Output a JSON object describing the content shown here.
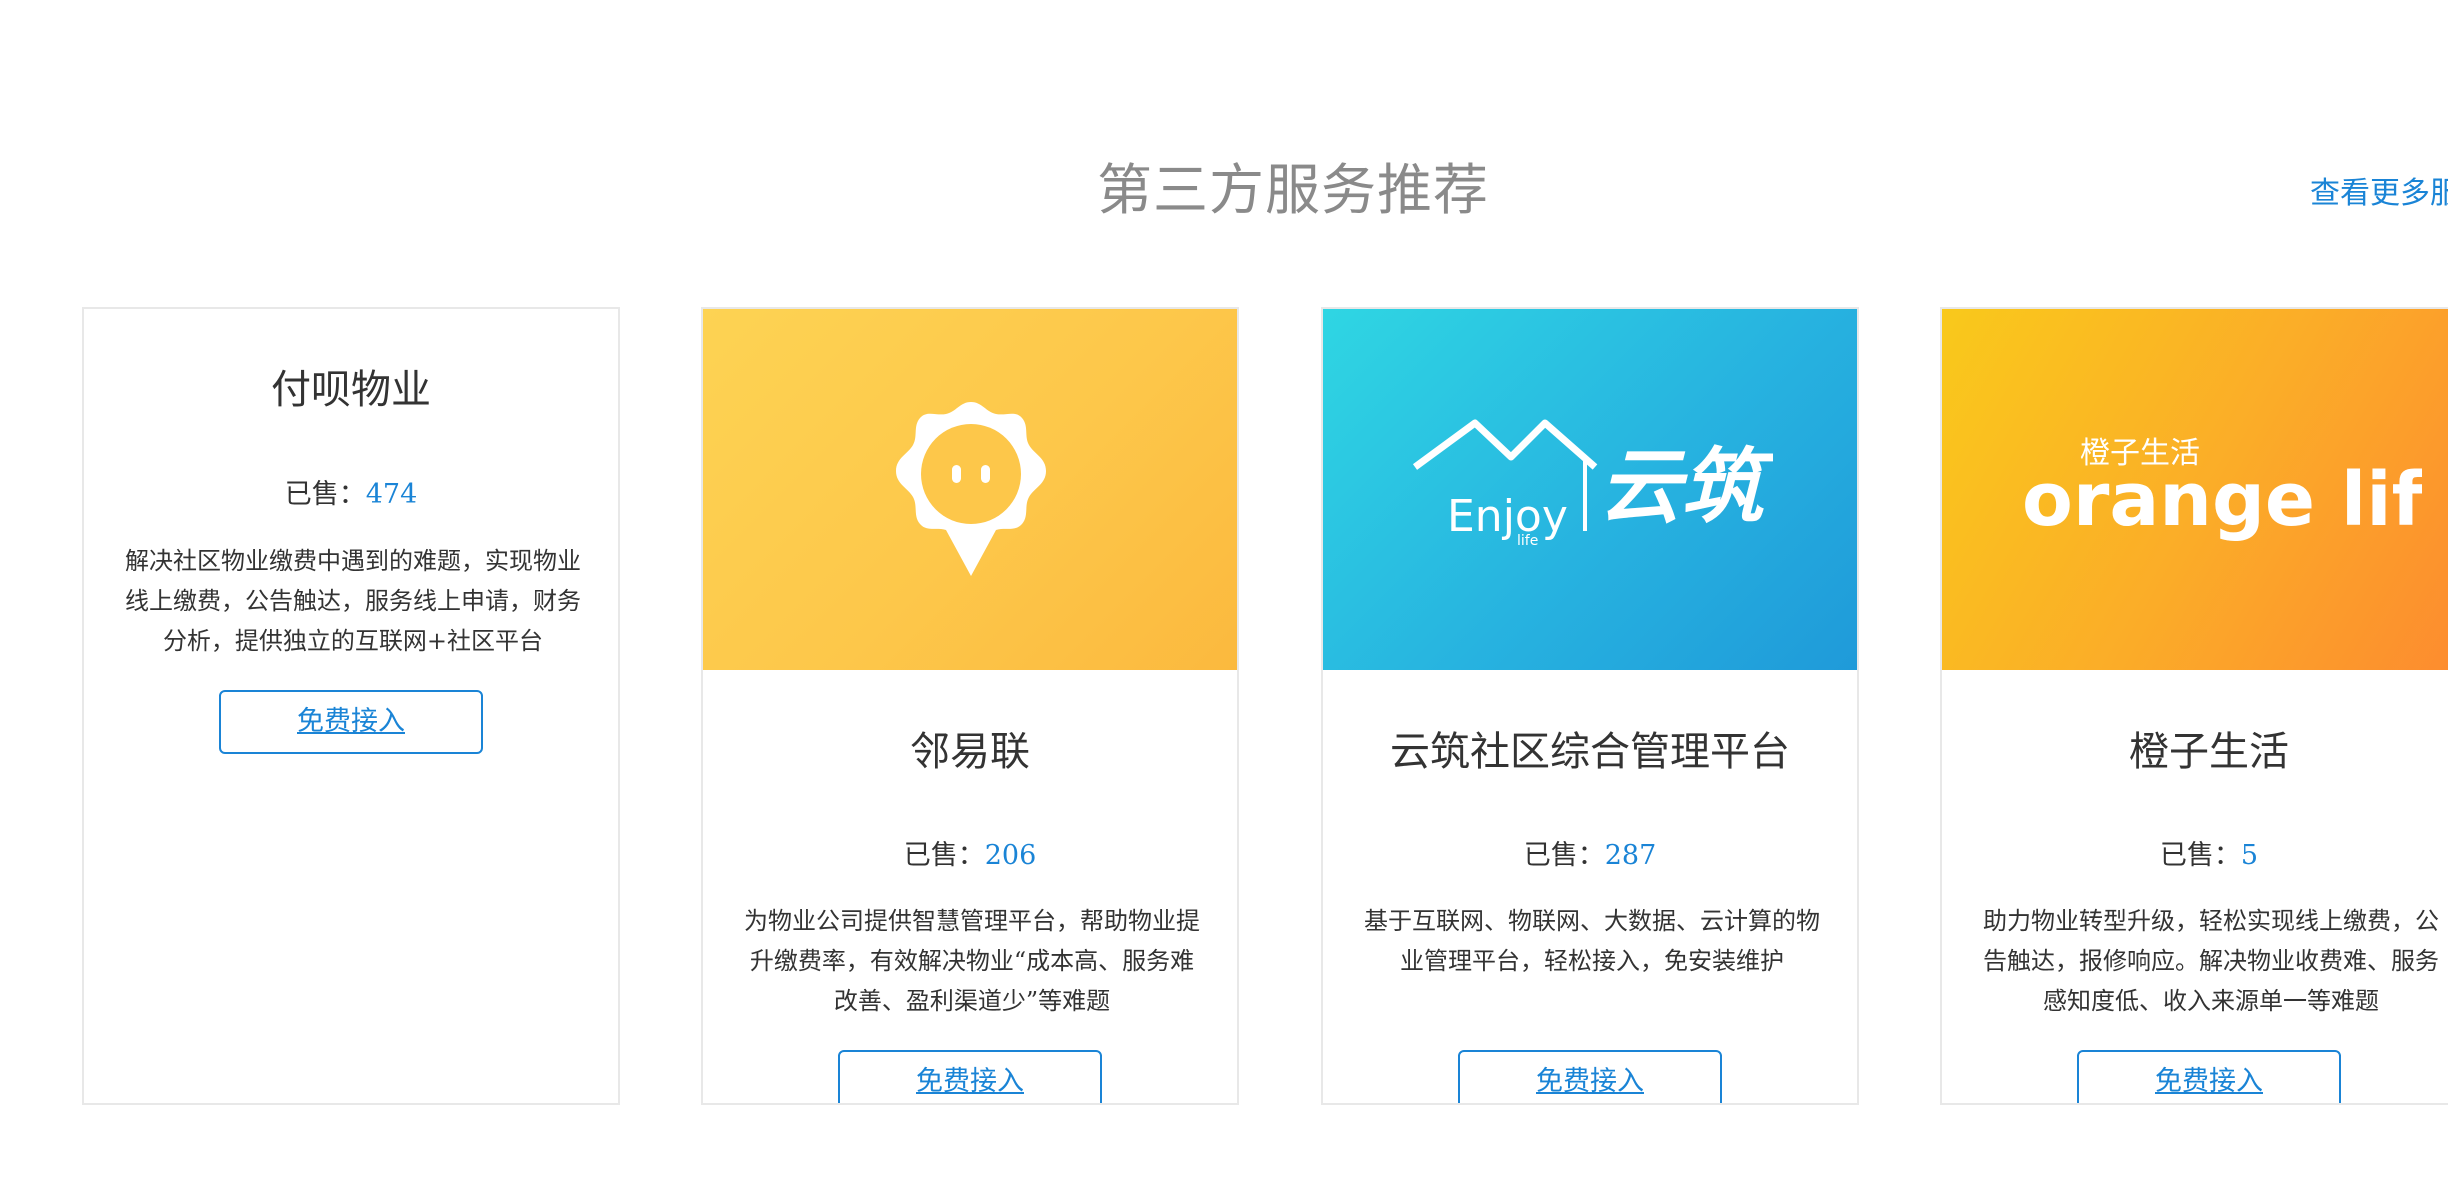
{
  "section": {
    "title": "第三方服务推荐",
    "more_link": "查看更多服"
  },
  "cards": [
    {
      "title": "付呗物业",
      "sold_label": "已售：",
      "sold_count": "474",
      "description": "解决社区物业缴费中遇到的难题，实现物业线上缴费，公告触达，服务线上申请，财务分析，提供独立的互联网+社区平台",
      "button": "免费接入"
    },
    {
      "title": "邻易联",
      "sold_label": "已售：",
      "sold_count": "206",
      "description": "为物业公司提供智慧管理平台，帮助物业提升缴费率，有效解决物业“成本高、服务难改善、盈利渠道少”等难题",
      "button": "免费接入",
      "logo": "linyilian-logo",
      "banner_color": "#fdc74a"
    },
    {
      "title": "云筑社区综合管理平台",
      "sold_label": "已售：",
      "sold_count": "287",
      "description": "基于互联网、物联网、大数据、云计算的物业管理平台，轻松接入，免安装维护",
      "button": "免费接入",
      "logo_text": {
        "enjoy": "Enjoy",
        "life": "life",
        "brand": "云筑"
      },
      "banner_color": "#27b3e0"
    },
    {
      "title": "橙子生活",
      "sold_label": "已售：",
      "sold_count": "5",
      "description": "助力物业转型升级，轻松实现线上缴费，公告触达，报修响应。解决物业收费难、服务感知度低、收入来源单一等难题",
      "button": "免费接入",
      "logo_text": {
        "small": "橙子生活",
        "main": "orange life"
      },
      "banner_color": "#fbad28"
    }
  ]
}
